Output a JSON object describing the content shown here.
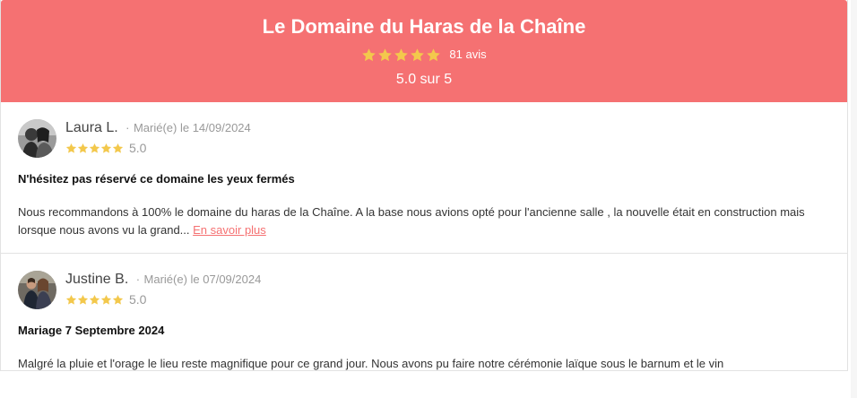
{
  "header": {
    "title": "Le Domaine du Haras de la Chaîne",
    "review_count": "81 avis",
    "score_text": "5.0 sur 5",
    "stars": 5,
    "accent_color": "#f57172",
    "star_color": "#f3c84c"
  },
  "reviews": [
    {
      "name": "Laura L.",
      "separator": "·",
      "date_text": "Marié(e) le 14/09/2024",
      "stars": 5,
      "score": "5.0",
      "title": "N'hésitez pas réservé ce domaine les yeux fermés",
      "text": "Nous recommandons à 100% le domaine du haras de la Chaîne. A la base nous avions opté pour l'ancienne salle , la nouvelle était en construction mais lorsque nous avons vu la grand...",
      "more_label": "En savoir plus",
      "avatar_icon": "couple-photo-bw"
    },
    {
      "name": "Justine B.",
      "separator": "·",
      "date_text": "Marié(e) le 07/09/2024",
      "stars": 5,
      "score": "5.0",
      "title": "Mariage 7 Septembre 2024",
      "text": "Malgré la pluie et l'orage le lieu reste magnifique pour ce grand jour. Nous avons pu faire notre cérémonie laïque sous le barnum et le vin",
      "avatar_icon": "couple-photo-color"
    }
  ]
}
